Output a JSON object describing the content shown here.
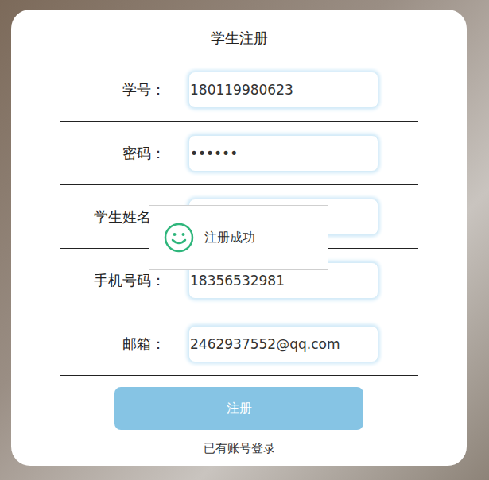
{
  "window": {
    "title": "学生注册"
  },
  "fields": [
    {
      "label": "学号：",
      "value": "180119980623"
    },
    {
      "label": "密码：",
      "value": "••••••"
    },
    {
      "label": "学生姓名：",
      "value": ""
    },
    {
      "label": "手机号码：",
      "value": "18356532981"
    },
    {
      "label": "邮箱：",
      "value": "2462937552@qq.com"
    }
  ],
  "buttons": [
    "注册"
  ],
  "link": "已有账号登录",
  "toast": {
    "message": "注册成功"
  }
}
